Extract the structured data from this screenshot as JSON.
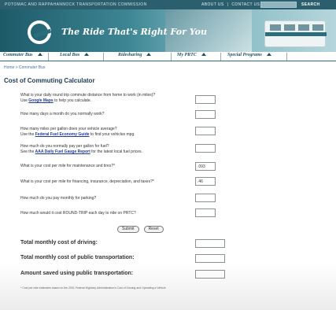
{
  "topbar": {
    "org": "POTOMAC AND RAPPAHANNOCK TRANSPORTATION COMMISSION",
    "about": "ABOUT US",
    "separator": "|",
    "contact": "CONTACT US",
    "search": "SEARCH"
  },
  "banner": {
    "slogan": "The Ride That's Right For You"
  },
  "nav": {
    "tabs": [
      "Commuter Bus",
      "Local Bus",
      "Ridesharing",
      "My PRTC",
      "Special Programs"
    ]
  },
  "breadcrumb": "Home > Commuter Bus",
  "page_title": "Cost of Commuting Calculator",
  "questions": [
    {
      "line1": "What is your daily round trip commute distance from home to work (in miles)?",
      "line2_prefix": "Use ",
      "link": "Google Maps",
      "line2_suffix": " to help you calculate.",
      "value": ""
    },
    {
      "line1": "How many days a month do you normally work?",
      "value": ""
    },
    {
      "line1": "How many miles per gallon does your vehicle average?",
      "line2_prefix": "Use the ",
      "link": "Federal Fuel Economy Guide",
      "line2_suffix": " to find your vehicles mpg.",
      "value": ""
    },
    {
      "line1": "How much do you normally pay per gallon for fuel?",
      "line2_prefix": "See the ",
      "link": "AAA Daily Fuel Gauge Report",
      "line2_suffix": " for the latest local fuel prices.",
      "value": ""
    },
    {
      "line1": "What is your cost per mile for maintenance and tires?*",
      "value": ".093"
    },
    {
      "line1": "What is your cost per mile for financing, insurance, depreciation, and taxes?*",
      "value": ".46"
    },
    {
      "line1": "How much do you pay monthly for parking?",
      "value": ""
    },
    {
      "line1": "How much would it cost ROUND-TRIP each day to ride on PRTC?",
      "value": ""
    }
  ],
  "buttons": {
    "submit": "Submit",
    "reset": "Reset"
  },
  "totals": {
    "driving": "Total monthly cost of driving:",
    "transit": "Total monthly cost of public transportation:",
    "saved": "Amount saved using public transportation:"
  },
  "footnote": "* Cost per mile estimates based on the 2001 Federal Highway Administration's Cost of Owning and Operating a Vehicle"
}
